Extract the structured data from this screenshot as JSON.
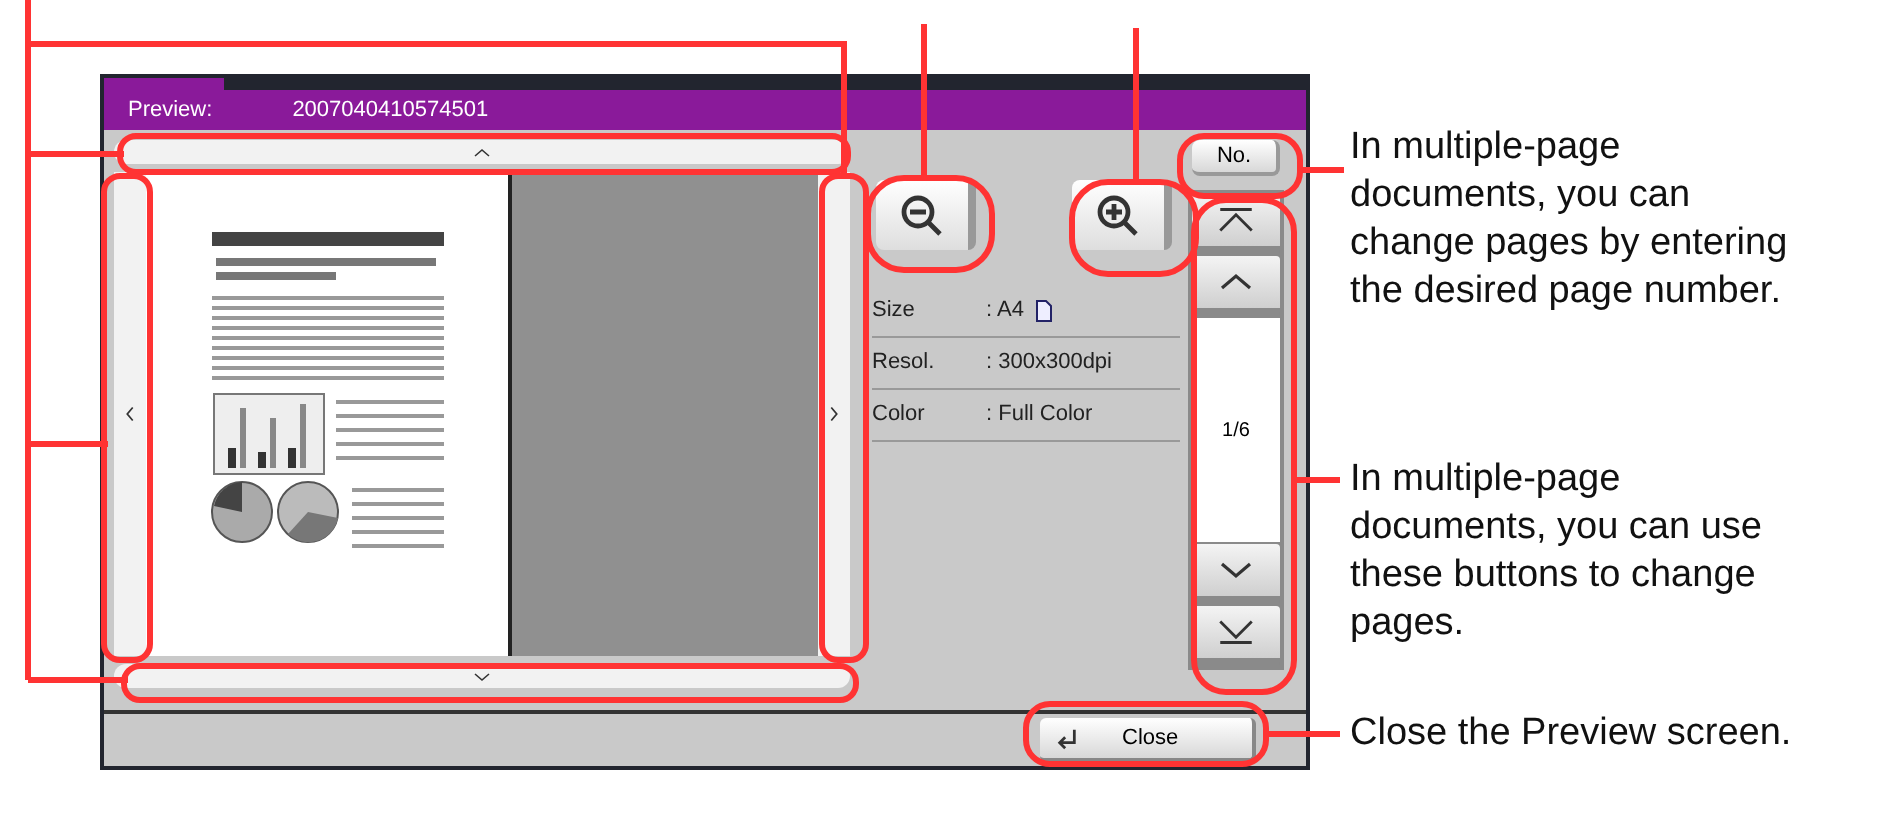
{
  "window": {
    "title_label": "Preview:",
    "title_value": "2007040410574501"
  },
  "info_rows": [
    {
      "label": "Size",
      "value": ": A4",
      "kind": "paper"
    },
    {
      "label": "Resol.",
      "value": ": 300x300dpi",
      "kind": "plain"
    },
    {
      "label": "Color",
      "value": ": Full Color",
      "kind": "plain"
    }
  ],
  "number_button": "No.",
  "page_indicator": "1/6",
  "close_button": "Close",
  "notes": [
    "In multiple-page documents, you can change pages by entering the desired page number.",
    "In multiple-page documents, you can use these buttons to change pages.",
    "Close the Preview screen."
  ]
}
